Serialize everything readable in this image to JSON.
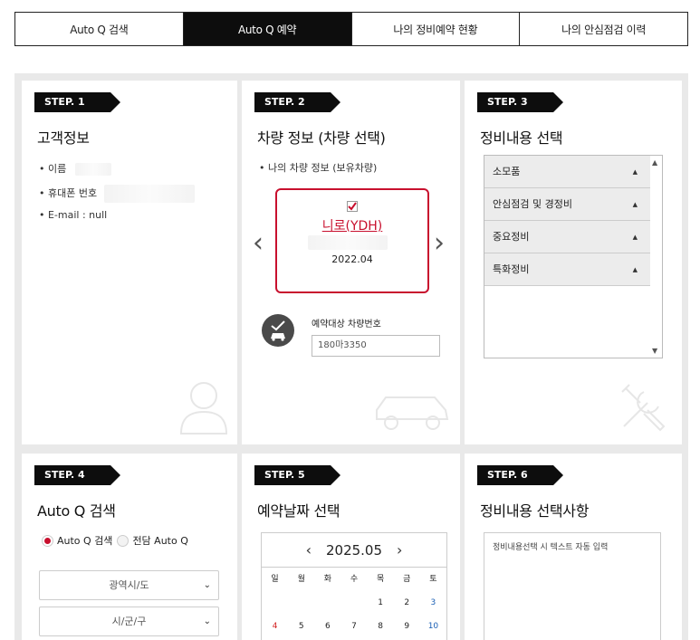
{
  "tabs": [
    {
      "label": "Auto Q 검색",
      "active": false
    },
    {
      "label": "Auto Q 예약",
      "active": true
    },
    {
      "label": "나의 정비예약 현황",
      "active": false
    },
    {
      "label": "나의 안심점검 이력",
      "active": false
    }
  ],
  "step1": {
    "step": "STEP. 1",
    "title": "고객정보",
    "name_label": "• 이름",
    "phone_label": "• 휴대폰 번호",
    "email_label": "• E-mail : null"
  },
  "step2": {
    "step": "STEP. 2",
    "title": "차량 정보 (차량 선택)",
    "subtitle": "• 나의 차량 정보 (보유차량)",
    "car_name": "니로(YDH)",
    "car_year": "2022.04",
    "plate_label": "예약대상 차량번호",
    "plate_value": "180마3350"
  },
  "step3": {
    "step": "STEP. 3",
    "title": "정비내용 선택",
    "items": [
      "소모품",
      "안심점검 및 경정비",
      "중요정비",
      "특화정비"
    ]
  },
  "step4": {
    "step": "STEP. 4",
    "title": "Auto Q 검색",
    "radio1": "Auto Q 검색",
    "radio2": "전담 Auto Q",
    "select1": "광역시/도",
    "select2": "시/군/구"
  },
  "step5": {
    "step": "STEP. 5",
    "title": "예약날짜 선택",
    "month": "2025.05",
    "weekdays": [
      "일",
      "월",
      "화",
      "수",
      "목",
      "금",
      "토"
    ],
    "row1": [
      "",
      "",
      "",
      "",
      "1",
      "2",
      "3"
    ],
    "row2": [
      "4",
      "5",
      "6",
      "7",
      "8",
      "9",
      "10"
    ]
  },
  "step6": {
    "step": "STEP. 6",
    "title": "정비내용 선택사항",
    "placeholder": "정비내용선택 시 텍스트 자동 입력"
  },
  "colors": {
    "accent": "#c8102e",
    "dark": "#0d0d0d",
    "sunday": "#d21f1f",
    "saturday": "#1a5fb4"
  }
}
